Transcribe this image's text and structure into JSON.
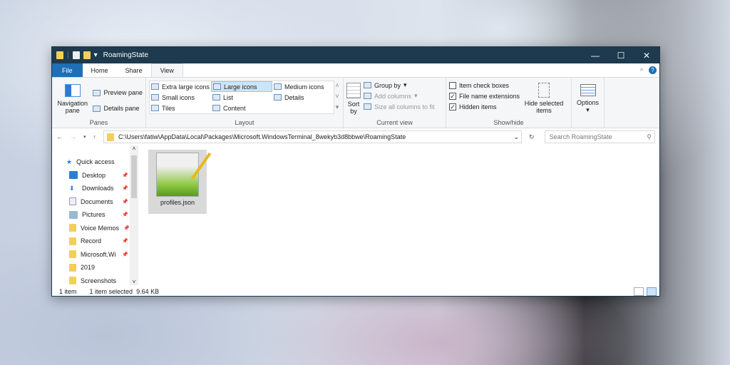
{
  "window": {
    "title": "RoamingState"
  },
  "tabs": [
    "File",
    "Home",
    "Share",
    "View"
  ],
  "ribbon": {
    "panes": {
      "navigation_pane": "Navigation pane",
      "preview_pane": "Preview pane",
      "details_pane": "Details pane",
      "label": "Panes"
    },
    "layout": {
      "items": [
        "Extra large icons",
        "Large icons",
        "Medium icons",
        "Small icons",
        "List",
        "Details",
        "Tiles",
        "Content"
      ],
      "selected": "Large icons",
      "label": "Layout"
    },
    "current_view": {
      "sort_by": "Sort by",
      "group_by": "Group by",
      "add_columns": "Add columns",
      "size_columns": "Size all columns to fit",
      "label": "Current view"
    },
    "show_hide": {
      "item_check_boxes": {
        "label": "Item check boxes",
        "checked": false
      },
      "file_name_extensions": {
        "label": "File name extensions",
        "checked": true
      },
      "hidden_items": {
        "label": "Hidden items",
        "checked": true
      },
      "hide_selected": "Hide selected items",
      "label": "Show/hide"
    },
    "options": "Options"
  },
  "address": {
    "path": "C:\\Users\\fatiw\\AppData\\Local\\Packages\\Microsoft.WindowsTerminal_8wekyb3d8bbwe\\RoamingState",
    "search_placeholder": "Search RoamingState"
  },
  "nav": {
    "quick_access": "Quick access",
    "items": [
      "Desktop",
      "Downloads",
      "Documents",
      "Pictures",
      "Voice Memos",
      "Record",
      "Microsoft.Wi",
      "2019",
      "Screenshots"
    ]
  },
  "files": [
    {
      "name": "profiles.json"
    }
  ],
  "status": {
    "count": "1 item",
    "selected": "1 item selected",
    "size": "9.64 KB"
  }
}
